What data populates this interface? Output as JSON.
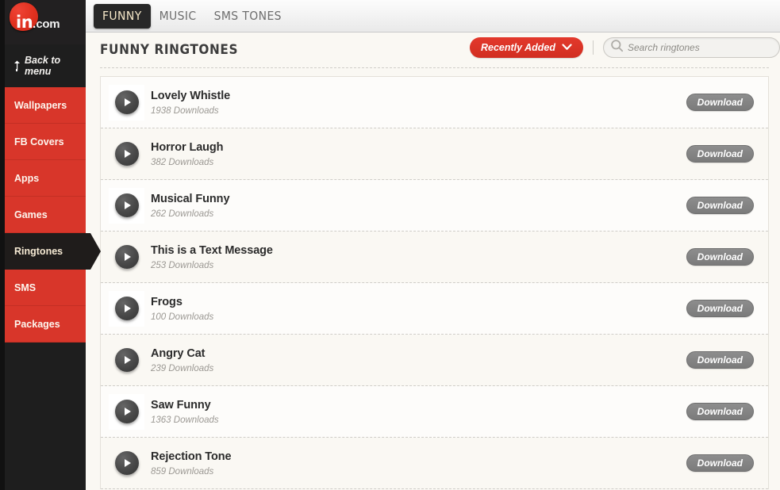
{
  "brand": {
    "logo_in": "in",
    "logo_dot": ".",
    "logo_com": "com",
    "accent_red": "#d8362a",
    "dark": "#1e1e1e"
  },
  "sidebar": {
    "back_label": "Back to menu",
    "back_icon": "up-arrow-icon",
    "items": [
      {
        "label": "Wallpapers",
        "active": false
      },
      {
        "label": "FB Covers",
        "active": false
      },
      {
        "label": "Apps",
        "active": false
      },
      {
        "label": "Games",
        "active": false
      },
      {
        "label": "Ringtones",
        "active": true
      },
      {
        "label": "SMS",
        "active": false
      },
      {
        "label": "Packages",
        "active": false
      }
    ]
  },
  "tabs": [
    {
      "label": "FUNNY",
      "active": true
    },
    {
      "label": "MUSIC",
      "active": false
    },
    {
      "label": "SMS TONES",
      "active": false
    }
  ],
  "page": {
    "title": "FUNNY RINGTONES"
  },
  "toolbar": {
    "sort_label": "Recently Added",
    "sort_icon": "chevron-down-icon",
    "search_icon": "search-icon",
    "search_value": "",
    "search_placeholder": "Search ringtones"
  },
  "list": {
    "download_label": "Download",
    "play_icon": "play-icon",
    "downloads_suffix": "Downloads",
    "items": [
      {
        "title": "Lovely Whistle",
        "downloads": "1938 Downloads",
        "highlight": true
      },
      {
        "title": "Horror Laugh",
        "downloads": "382 Downloads",
        "highlight": false
      },
      {
        "title": "Musical Funny",
        "downloads": "262 Downloads",
        "highlight": true
      },
      {
        "title": "This is a Text Message",
        "downloads": "253 Downloads",
        "highlight": false
      },
      {
        "title": "Frogs",
        "downloads": "100 Downloads",
        "highlight": true
      },
      {
        "title": "Angry Cat",
        "downloads": "239 Downloads",
        "highlight": false
      },
      {
        "title": "Saw Funny",
        "downloads": "1363 Downloads",
        "highlight": true
      },
      {
        "title": "Rejection Tone",
        "downloads": "859 Downloads",
        "highlight": false
      }
    ]
  }
}
